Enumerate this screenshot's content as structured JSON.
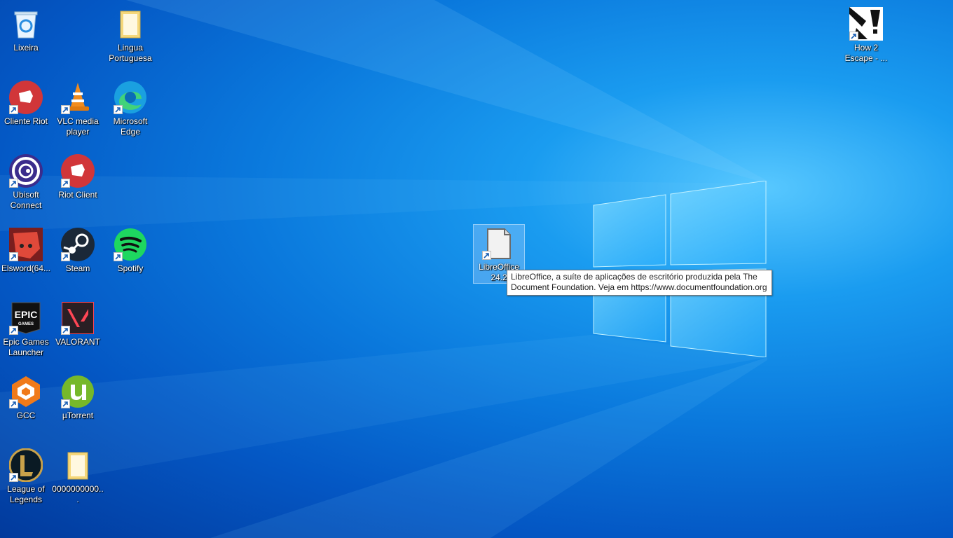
{
  "desktop": {
    "icons": {
      "recycle_bin": {
        "label": "Lixeira"
      },
      "lingua_portuguesa": {
        "label": "Lingua Portuguesa"
      },
      "how2escape": {
        "label": "How 2 Escape - ..."
      },
      "cliente_riot": {
        "label": "Cliente Riot"
      },
      "vlc": {
        "label": "VLC media player"
      },
      "edge": {
        "label": "Microsoft Edge"
      },
      "ubisoft": {
        "label": "Ubisoft Connect"
      },
      "riot_client": {
        "label": "Riot Client"
      },
      "elsword": {
        "label": "Elsword(64..."
      },
      "steam": {
        "label": "Steam"
      },
      "spotify": {
        "label": "Spotify"
      },
      "epic": {
        "label": "Epic Games Launcher"
      },
      "valorant": {
        "label": "VALORANT"
      },
      "gcc": {
        "label": "GCC"
      },
      "utorrent": {
        "label": "µTorrent"
      },
      "lol": {
        "label": "League of Legends"
      },
      "folder_zeros": {
        "label": "0000000000..."
      },
      "libreoffice": {
        "label": "LibreOffice 24.2"
      }
    },
    "tooltip": {
      "line1": "LibreOffice, a suíte de aplicações de escritório produzida pela The",
      "line2": "Document Foundation. Veja em https://www.documentfoundation.org"
    }
  },
  "colors": {
    "background_accent": "#0a78dc",
    "tooltip_bg": "#ffffff",
    "riot_red": "#d13639",
    "spotify_green": "#1ed760"
  }
}
